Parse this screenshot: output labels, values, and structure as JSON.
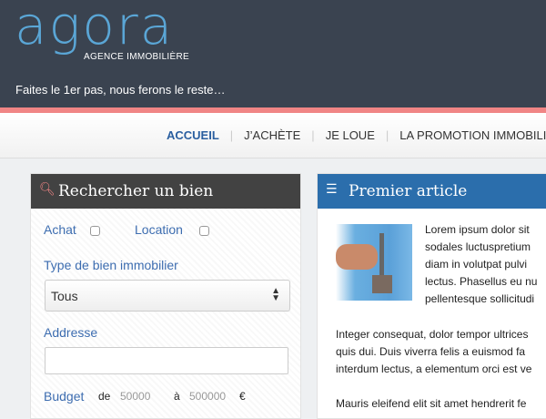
{
  "header": {
    "logo": "agora",
    "subtitle": "AGENCE IMMOBILIÈRE",
    "tagline": "Faites le 1er pas, nous ferons le reste…"
  },
  "nav": {
    "items": [
      "ACCUEIL",
      "J’ACHÈTE",
      "JE LOUE",
      "LA PROMOTION IMMOBILIÈRE"
    ],
    "separator": "|"
  },
  "search": {
    "title": "Rechercher un bien",
    "achat": "Achat",
    "location": "Location",
    "type_label": "Type de bien immobilier",
    "type_value": "Tous",
    "address_label": "Addresse",
    "budget_label": "Budget",
    "de": "de",
    "min_placeholder": "50000",
    "a": "à",
    "max_placeholder": "500000",
    "currency": "€"
  },
  "article": {
    "title": "Premier article",
    "p1": [
      "Lorem ipsum dolor sit",
      "sodales luctuspretium",
      "diam in volutpat pulvi",
      "lectus. Phasellus eu nu",
      "pellentesque sollicitudi"
    ],
    "p2": [
      "Integer consequat, dolor tempor ultrices",
      "quis dui. Duis viverra felis a euismod fa",
      "interdum lectus, a elementum orci est ve"
    ],
    "p3": "Mauris eleifend elit sit amet hendrerit fe"
  }
}
